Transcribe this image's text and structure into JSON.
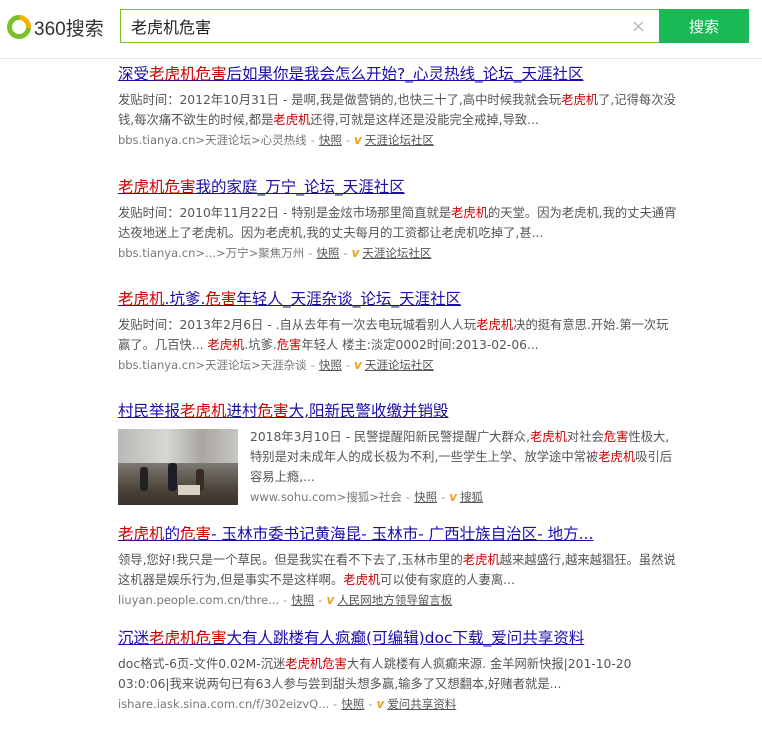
{
  "header": {
    "logo_text": "360搜索",
    "query": "老虎机危害",
    "search_button": "搜索",
    "clear_glyph": "×"
  },
  "results": [
    {
      "title_parts": [
        {
          "t": "深受",
          "hl": false
        },
        {
          "t": "老虎机危害",
          "hl": true
        },
        {
          "t": "后如果你是我会怎么开始?_心灵热线_论坛_天涯社区",
          "hl": false
        }
      ],
      "body_parts": [
        {
          "t": "发贴时间：2012年10月31日 - 是啊,我是做营销的,也快三十了,高中时候我就会玩",
          "hl": false
        },
        {
          "t": "老虎机",
          "hl": true
        },
        {
          "t": "了,记得每次没钱,每次痛不欲生的时候,都是",
          "hl": false
        },
        {
          "t": "老虎机",
          "hl": true
        },
        {
          "t": "还得,可就是这样还是没能完全戒掉,导致...",
          "hl": false
        }
      ],
      "url": "bbs.tianya.cn>天涯论坛>心灵热线",
      "snapshot": "快照",
      "source": "天涯论坛社区"
    },
    {
      "title_parts": [
        {
          "t": "老虎机危害",
          "hl": true
        },
        {
          "t": "我的家庭_万宁_论坛_天涯社区",
          "hl": false
        }
      ],
      "body_parts": [
        {
          "t": "发贴时间：2010年11月22日 - 特别是金炫市场那里简直就是",
          "hl": false
        },
        {
          "t": "老虎机",
          "hl": true
        },
        {
          "t": "的天堂。因为老虎机,我的丈夫通宵达夜地迷上了老虎机。因为老虎机,我的丈夫每月的工资都让老虎机吃掉了,甚...",
          "hl": false
        }
      ],
      "url": "bbs.tianya.cn>...>万宁>聚焦万州",
      "snapshot": "快照",
      "source": "天涯论坛社区"
    },
    {
      "title_parts": [
        {
          "t": "老虎机",
          "hl": true
        },
        {
          "t": ".坑爹.",
          "hl": false
        },
        {
          "t": "危害",
          "hl": true
        },
        {
          "t": "年轻人_天涯杂谈_论坛_天涯社区",
          "hl": false
        }
      ],
      "body_parts": [
        {
          "t": "发贴时间：2013年2月6日 - .自从去年有一次去电玩城看别人人玩",
          "hl": false
        },
        {
          "t": "老虎机",
          "hl": true
        },
        {
          "t": "决的挺有意思.开始.第一次玩赢了。几百快... ",
          "hl": false
        },
        {
          "t": "老虎机",
          "hl": true
        },
        {
          "t": ".坑爹.",
          "hl": false
        },
        {
          "t": "危害",
          "hl": true
        },
        {
          "t": "年轻人 楼主:淡定0002时间:2013-02-06...",
          "hl": false
        }
      ],
      "url": "bbs.tianya.cn>天涯论坛>天涯杂谈",
      "snapshot": "快照",
      "source": "天涯论坛社区"
    },
    {
      "title_parts": [
        {
          "t": "村民举报",
          "hl": false
        },
        {
          "t": "老虎机",
          "hl": true
        },
        {
          "t": "进村",
          "hl": false
        },
        {
          "t": "危害",
          "hl": true
        },
        {
          "t": "大,阳新民警收缴并销毁",
          "hl": false
        }
      ],
      "body_parts": [
        {
          "t": "2018年3月10日 - 民警提醒阳新民警提醒广大群众,",
          "hl": false
        },
        {
          "t": "老虎机",
          "hl": true
        },
        {
          "t": "对社会",
          "hl": false
        },
        {
          "t": "危害",
          "hl": true
        },
        {
          "t": "性极大,特别是对未成年人的成长极为不利,一些学生上学、放学途中常被",
          "hl": false
        },
        {
          "t": "老虎机",
          "hl": true
        },
        {
          "t": "吸引后容易上瘾,...",
          "hl": false
        }
      ],
      "url": "www.sohu.com>搜狐>社会",
      "snapshot": "快照",
      "source": "搜狐",
      "has_image": true
    },
    {
      "title_parts": [
        {
          "t": "老虎机",
          "hl": true
        },
        {
          "t": "的",
          "hl": false
        },
        {
          "t": "危害",
          "hl": true
        },
        {
          "t": "- 玉林市委书记黄海昆- 玉林市- 广西壮族自治区- 地方...",
          "hl": false
        }
      ],
      "body_parts": [
        {
          "t": "领导,您好!我只是一个草民。但是我实在看不下去了,玉林市里的",
          "hl": false
        },
        {
          "t": "老虎机",
          "hl": true
        },
        {
          "t": "越来越盛行,越来越猖狂。虽然说这机器是娱乐行为,但是事实不是这样啊。",
          "hl": false
        },
        {
          "t": "老虎机",
          "hl": true
        },
        {
          "t": "可以使有家庭的人妻离...",
          "hl": false
        }
      ],
      "url": "liuyan.people.com.cn/thre...",
      "snapshot": "快照",
      "source": "人民网地方领导留言板"
    },
    {
      "title_parts": [
        {
          "t": "沉迷",
          "hl": false
        },
        {
          "t": "老虎机危害",
          "hl": true
        },
        {
          "t": "大有人跳楼有人疯癫(可编辑)doc下载_爱问共享资料",
          "hl": false
        }
      ],
      "body_parts": [
        {
          "t": "doc格式-6页-文件0.02M-沉迷",
          "hl": false
        },
        {
          "t": "老虎机危害",
          "hl": true
        },
        {
          "t": "大有人跳楼有人疯癫来源. 金羊网新快报|201-10-20 03:0:06|我来说两句已有63人参与尝到甜头想多赢,输多了又想翻本,好赌者就是...",
          "hl": false
        }
      ],
      "url": "ishare.iask.sina.com.cn/f/302eizvQ...",
      "snapshot": "快照",
      "source": "爱问共享资料"
    }
  ]
}
